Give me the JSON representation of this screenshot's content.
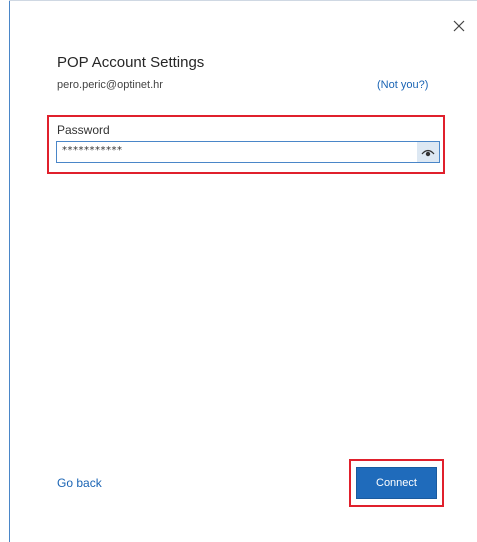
{
  "dialog": {
    "title": "POP Account Settings",
    "email": "pero.peric@optinet.hr",
    "not_you_link": "(Not you?)",
    "close_icon": "close-icon"
  },
  "password": {
    "label": "Password",
    "value": "***********",
    "reveal_icon": "eye-icon"
  },
  "footer": {
    "go_back_link": "Go back",
    "connect_label": "Connect"
  },
  "colors": {
    "accent": "#1f6bbb",
    "link": "#1a64b4",
    "highlight": "#e0202c"
  }
}
